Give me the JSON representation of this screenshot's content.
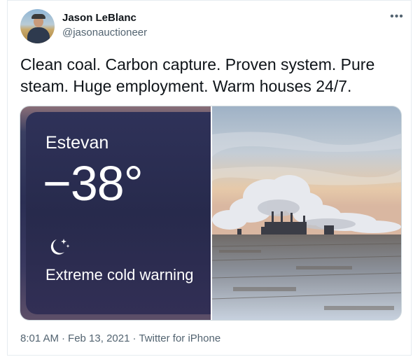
{
  "author": {
    "display_name": "Jason LeBlanc",
    "handle": "@jasonauctioneer"
  },
  "more_icon": "more-horizontal-icon",
  "tweet": {
    "text": "Clean coal. Carbon capture.  Proven system. Pure steam. Huge employment. Warm houses 24/7."
  },
  "media": {
    "weather": {
      "city": "Estevan",
      "temperature": "−38°",
      "condition_icon": "moon-stars-icon",
      "alert": "Extreme cold warning"
    },
    "photo": {
      "subject_icon": "power-plant-photo"
    }
  },
  "meta": {
    "time": "8:01 AM",
    "date": "Feb 13, 2021",
    "source": "Twitter for iPhone",
    "separator": "·"
  },
  "colors": {
    "text_primary": "#0f1419",
    "text_secondary": "#536471",
    "weather_bg": "#2b2f54",
    "border": "#cfd9de"
  }
}
